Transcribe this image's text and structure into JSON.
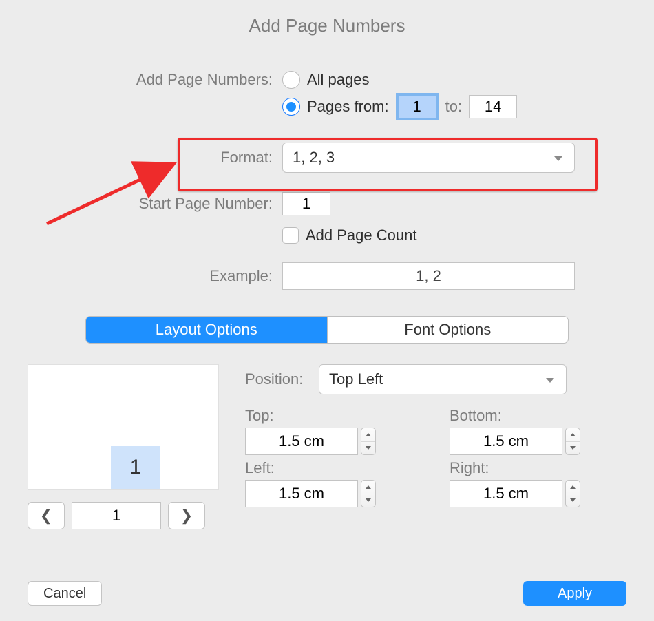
{
  "title": "Add Page Numbers",
  "section1": {
    "label": "Add Page Numbers:",
    "opt_all": "All pages",
    "opt_from": "Pages from:",
    "from_val": "1",
    "to_label": "to:",
    "to_val": "14"
  },
  "format": {
    "label": "Format:",
    "value": "1, 2, 3"
  },
  "start": {
    "label": "Start Page Number:",
    "value": "1"
  },
  "addcount": {
    "label": "Add Page Count"
  },
  "example": {
    "label": "Example:",
    "value": "1, 2"
  },
  "tabs": {
    "layout": "Layout Options",
    "font": "Font Options"
  },
  "position": {
    "label": "Position:",
    "value": "Top Left"
  },
  "margins": {
    "top_label": "Top:",
    "top_val": "1.5 cm",
    "bottom_label": "Bottom:",
    "bottom_val": "1.5 cm",
    "left_label": "Left:",
    "left_val": "1.5 cm",
    "right_label": "Right:",
    "right_val": "1.5 cm"
  },
  "preview": {
    "num": "1",
    "page": "1"
  },
  "buttons": {
    "cancel": "Cancel",
    "apply": "Apply"
  }
}
